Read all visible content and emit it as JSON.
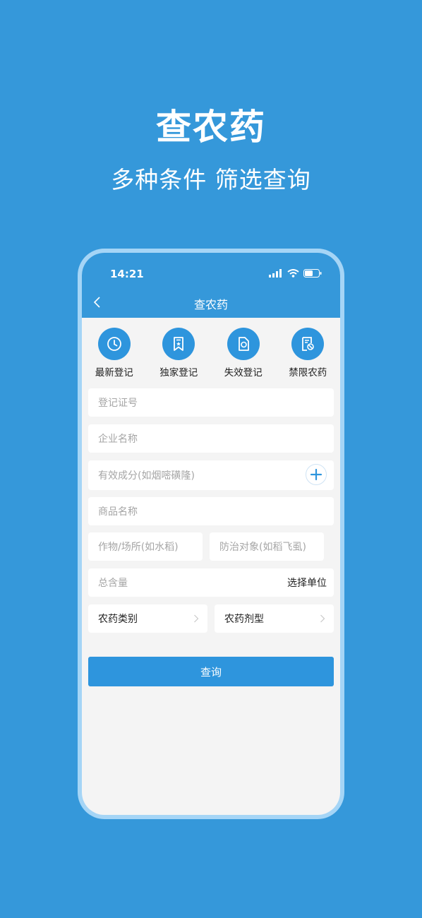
{
  "promo": {
    "title": "查农药",
    "subtitle": "多种条件 筛选查询"
  },
  "status_bar": {
    "time": "14:21"
  },
  "nav": {
    "title": "查农药",
    "back_icon": "chevron-left-icon"
  },
  "quick_actions": [
    {
      "label": "最新登记",
      "icon": "clock-icon"
    },
    {
      "label": "独家登记",
      "icon": "bookmark-star-icon"
    },
    {
      "label": "失效登记",
      "icon": "document-invalid-icon"
    },
    {
      "label": "禁限农药",
      "icon": "document-ban-icon"
    }
  ],
  "form": {
    "registration_no_placeholder": "登记证号",
    "company_name_placeholder": "企业名称",
    "ingredient_placeholder": "有效成分(如烟嘧磺隆)",
    "product_name_placeholder": "商品名称",
    "crop_placeholder": "作物/场所(如水稻)",
    "target_placeholder": "防治对象(如稻飞虱)",
    "total_content_placeholder": "总含量",
    "unit_select_label": "选择单位",
    "pesticide_category_label": "农药类别",
    "formulation_label": "农药剂型",
    "query_button_label": "查询"
  },
  "colors": {
    "brand_blue": "#3598DA",
    "button_blue": "#2E95DD",
    "phone_frame": "#A5D5F6",
    "screen_bg": "#F4F4F4"
  }
}
